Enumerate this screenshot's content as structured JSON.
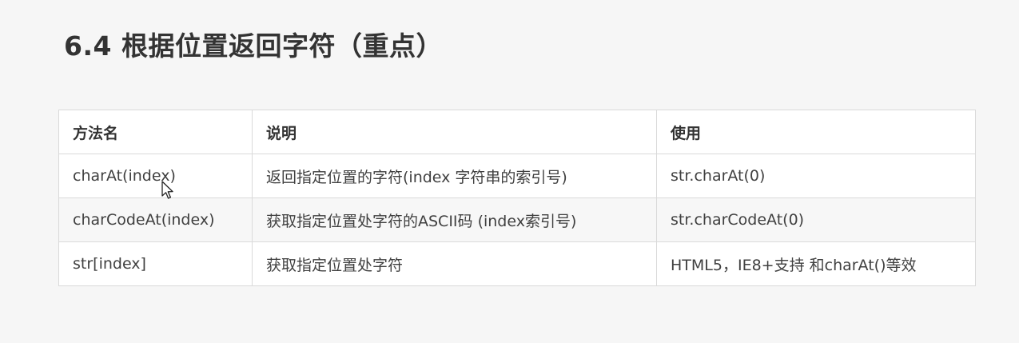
{
  "title": "6.4 根据位置返回字符（重点）",
  "table": {
    "headers": [
      "方法名",
      "说明",
      "使用"
    ],
    "rows": [
      [
        "charAt(index)",
        "返回指定位置的字符(index 字符串的索引号)",
        "str.charAt(0)"
      ],
      [
        "charCodeAt(index)",
        "获取指定位置处字符的ASCII码 (index索引号)",
        "str.charCodeAt(0)"
      ],
      [
        "str[index]",
        "获取指定位置处字符",
        "HTML5，IE8+支持 和charAt()等效"
      ]
    ]
  },
  "cursor_icon": "mouse-pointer-icon"
}
